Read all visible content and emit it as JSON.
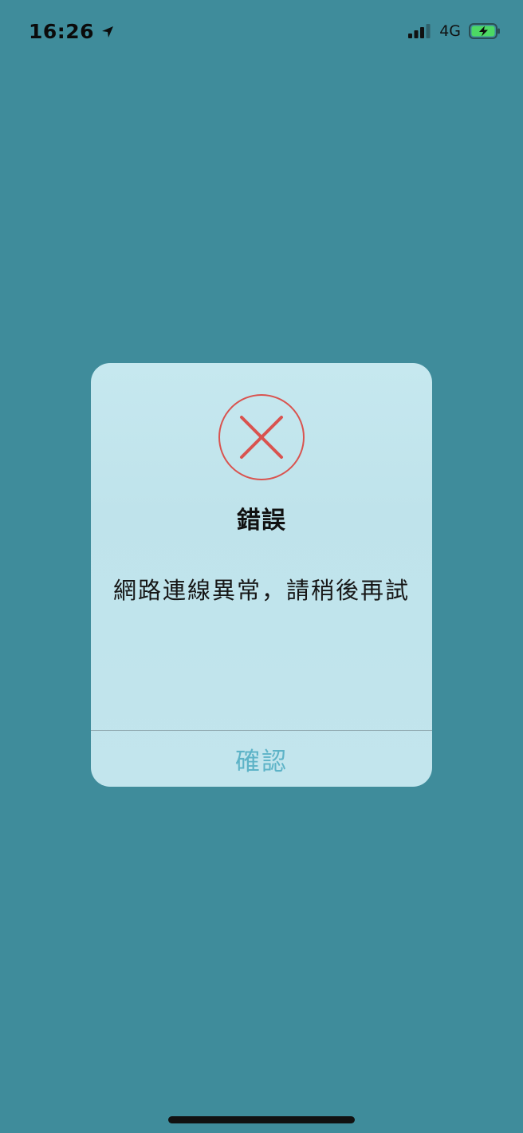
{
  "status_bar": {
    "time": "16:26",
    "network": "4G",
    "icons": [
      "location-arrow-icon",
      "signal-bars-icon",
      "battery-charging-icon"
    ]
  },
  "dialog": {
    "title": "錯誤",
    "message": "網路連線異常，請稍後再試",
    "confirm_label": "確認",
    "icon": "error-circle-x-icon"
  },
  "colors": {
    "background": "#3f8c9b",
    "dialog_background": "#c2e5ed",
    "error_red": "#d9534f",
    "confirm_text": "#5db3c7",
    "battery_fill": "#4cd964"
  }
}
